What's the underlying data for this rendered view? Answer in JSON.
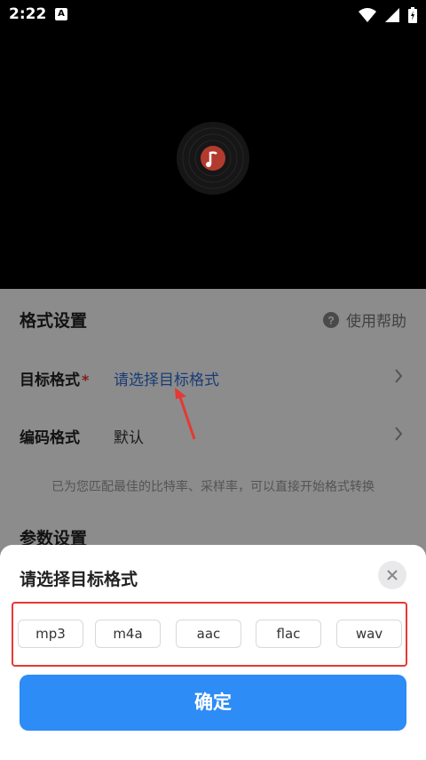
{
  "status_bar": {
    "time": "2:22",
    "notification_badge": "A"
  },
  "settings": {
    "format_section_title": "格式设置",
    "help_label": "使用帮助",
    "target_format_label": "目标格式",
    "required_mark": "*",
    "target_format_value": "请选择目标格式",
    "encoding_label": "编码格式",
    "encoding_value": "默认",
    "note": "已为您匹配最佳的比特率、采样率，可以直接开始格式转换",
    "param_section_title": "参数设置"
  },
  "sheet": {
    "title": "请选择目标格式",
    "formats": [
      "mp3",
      "m4a",
      "aac",
      "flac",
      "wav"
    ],
    "confirm_label": "确定"
  },
  "colors": {
    "accent": "#2d8cf5",
    "highlight_border": "#e53935",
    "link": "#2f6ed8"
  }
}
